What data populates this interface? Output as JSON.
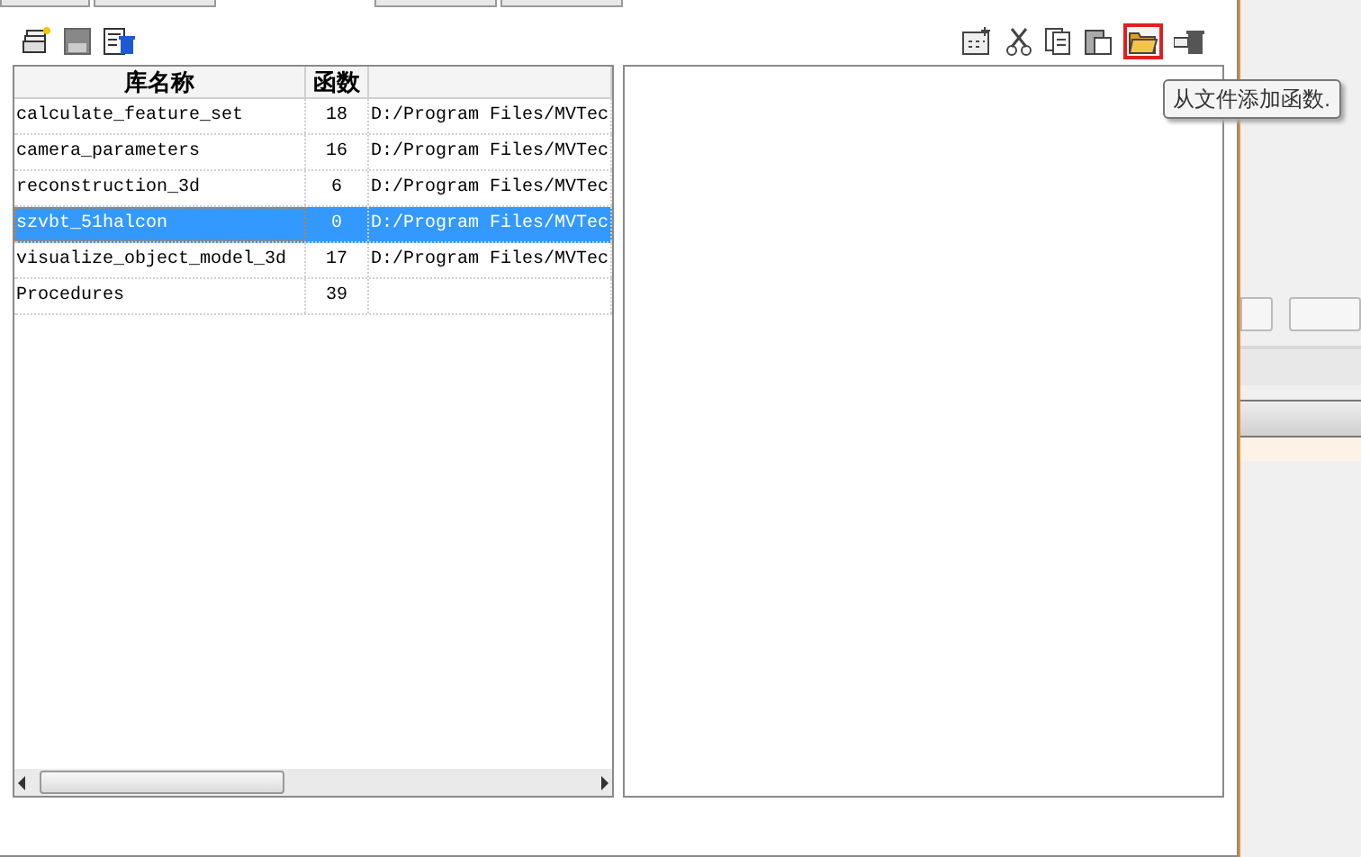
{
  "library_table": {
    "columns": [
      "库名称",
      "函数"
    ],
    "rows": [
      {
        "name": "calculate_feature_set",
        "count": "18",
        "path": "D:/Program Files/MVTec",
        "selected": false
      },
      {
        "name": "camera_parameters",
        "count": "16",
        "path": "D:/Program Files/MVTec",
        "selected": false
      },
      {
        "name": "reconstruction_3d",
        "count": "6",
        "path": "D:/Program Files/MVTec",
        "selected": false
      },
      {
        "name": "szvbt_51halcon",
        "count": "0",
        "path": "D:/Program Files/MVTec",
        "selected": true
      },
      {
        "name": "visualize_object_model_3d",
        "count": "17",
        "path": "D:/Program Files/MVTec",
        "selected": false
      },
      {
        "name": "Procedures",
        "count": "39",
        "path": "",
        "selected": false
      }
    ]
  },
  "procedure_toolbar": {
    "tooltip": "从文件添加函数."
  }
}
